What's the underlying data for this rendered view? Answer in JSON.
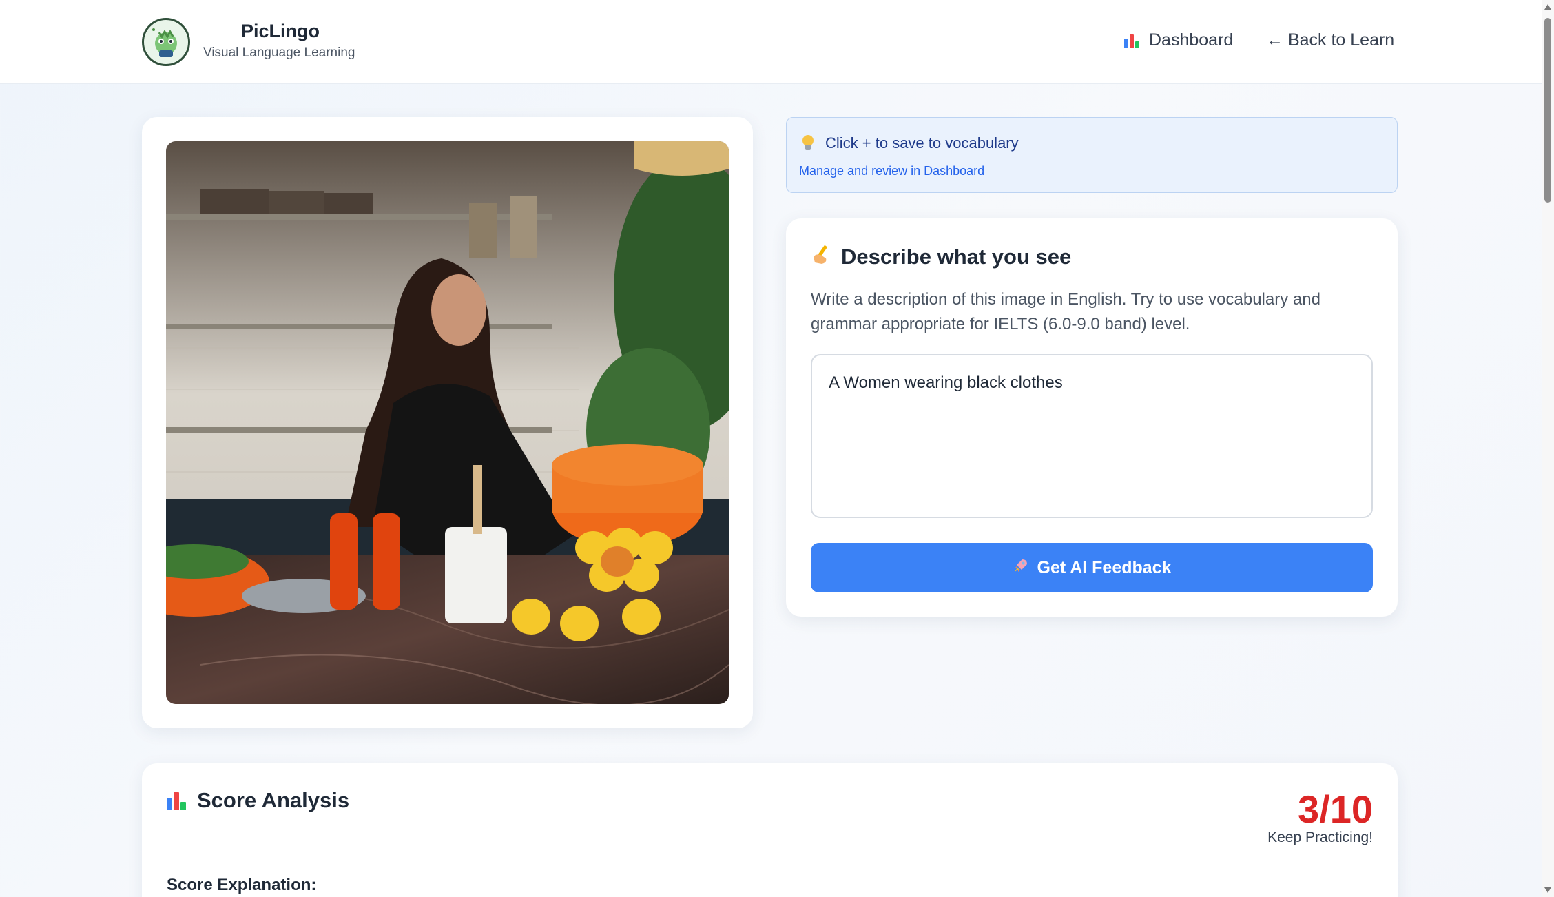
{
  "header": {
    "brand_name": "PicLingo",
    "brand_tagline": "Visual Language Learning",
    "nav_dashboard": "Dashboard",
    "nav_back": "← Back to Learn"
  },
  "tip": {
    "title": "Click + to save to vocabulary",
    "subtitle": "Manage and review in Dashboard"
  },
  "describe": {
    "title": "Describe what you see",
    "instructions": "Write a description of this image in English. Try to use vocabulary and grammar appropriate for IELTS (6.0-9.0 band) level.",
    "answer_value": "A Women wearing black clothes",
    "button_label": "Get AI Feedback"
  },
  "score": {
    "title": "Score Analysis",
    "value": "3/10",
    "note": "Keep Practicing!",
    "explanation_label": "Score Explanation:"
  },
  "colors": {
    "accent": "#3b82f6",
    "score_red": "#dc2626",
    "tip_bg": "#eaf2fd",
    "tip_text": "#1e3a8a"
  },
  "icons": {
    "logo": "dragon-mascot-icon",
    "dashboard": "bar-chart-icon",
    "tip": "lightbulb-icon",
    "describe": "writing-hand-icon",
    "button": "rocket-icon",
    "score": "bar-chart-icon"
  }
}
